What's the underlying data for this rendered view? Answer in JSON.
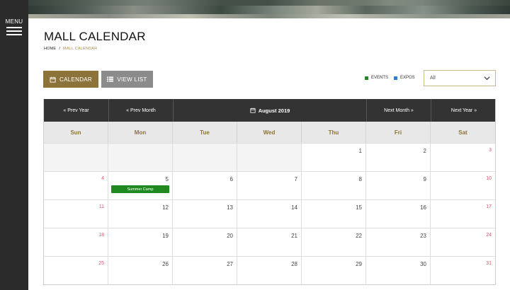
{
  "sidebar": {
    "menu_label": "MENU"
  },
  "page": {
    "title": "MALL CALENDAR"
  },
  "breadcrumb": {
    "home": "HOME",
    "separator": "/",
    "current": "MALL CALENDAR"
  },
  "view_buttons": {
    "calendar_label": "CALENDAR",
    "list_label": "VIEW LIST"
  },
  "legend": [
    {
      "label": "EVENTS",
      "color": "#1f8a1f"
    },
    {
      "label": "EXPOS",
      "color": "#2a7fd4"
    }
  ],
  "filter": {
    "selected": "All"
  },
  "calendar": {
    "prev_year": "« Prev Year",
    "prev_month": "« Prev Month",
    "month_title": "August 2019",
    "next_month": "Next Month »",
    "next_year": "Next Year »",
    "weekdays": [
      "Sun",
      "Mon",
      "Tue",
      "Wed",
      "Thu",
      "Fri",
      "Sat"
    ],
    "leading_blanks": 4,
    "days_in_month": 31,
    "events": [
      {
        "day": 5,
        "title": "Summer Camp",
        "type": "event"
      }
    ]
  },
  "colors": {
    "accent": "#8c733a",
    "weekend_day": "#e0566a",
    "header_bar": "#333333"
  }
}
